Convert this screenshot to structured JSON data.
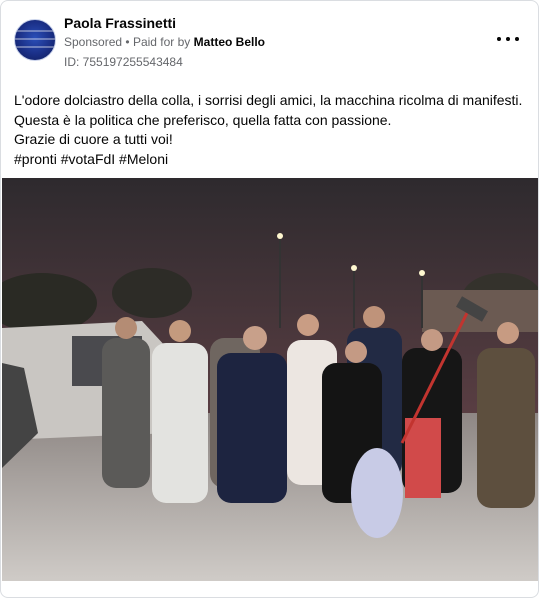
{
  "post": {
    "author_name": "Paola Frassinetti",
    "sponsored_label": "Sponsored",
    "separator": "•",
    "paid_for_prefix": "Paid for by",
    "paid_for_name": "Matteo Bello",
    "ad_id": "ID: 755197255543484",
    "text_lines": [
      "L'odore dolciastro della colla, i sorrisi degli amici, la macchina ricolma di manifesti.",
      "Questa è la politica che preferisco, quella fatta con passione.",
      "Grazie di cuore a tutti voi!",
      "#pronti #votaFdI #Meloni"
    ],
    "more_options_icon": "more-options-icon",
    "avatar_icon": "profile-avatar"
  },
  "photo": {
    "description_icon": "group-photo-image",
    "sky_color": "#3a2f33",
    "ground_color": "#b9b6b3"
  }
}
